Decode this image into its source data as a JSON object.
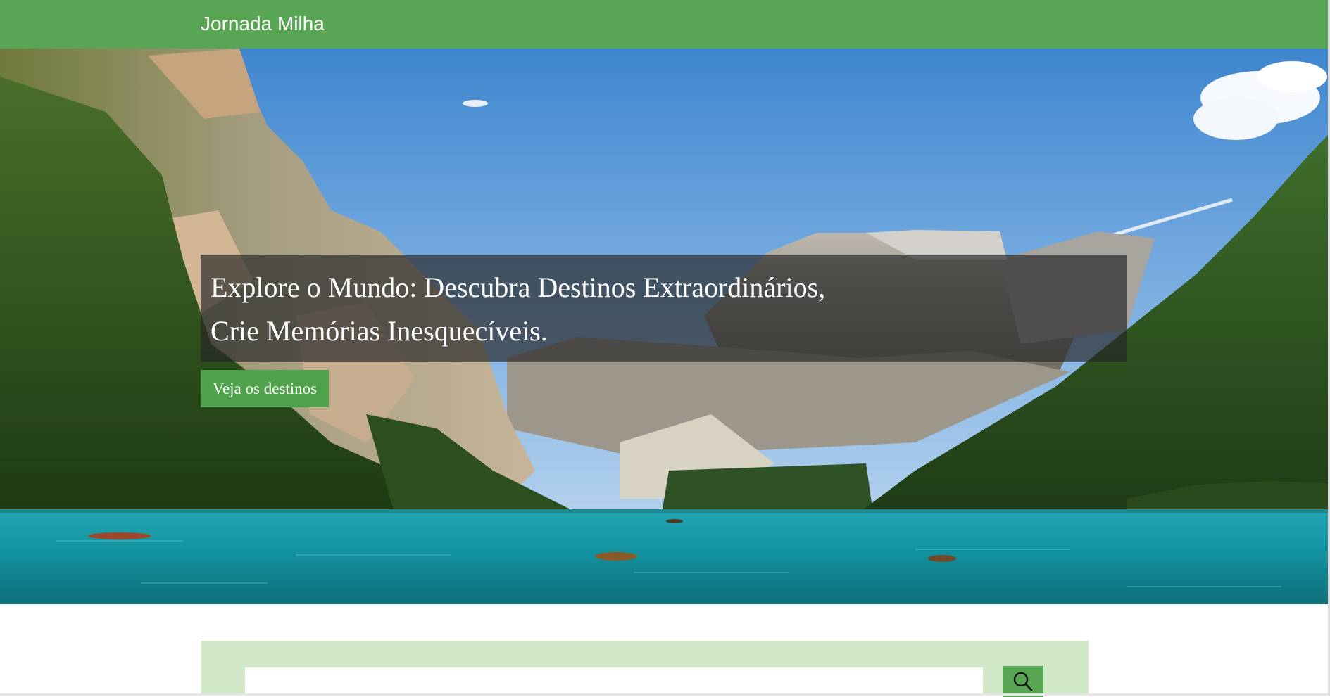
{
  "navbar": {
    "brand": "Jornada Milha",
    "background_color": "#58a653"
  },
  "hero": {
    "image_icon": "mountain-lake-image",
    "headline_line1": "Explore o Mundo: Descubra Destinos Extraordinários,",
    "headline_line2": "Crie Memórias Inesquecíveis.",
    "cta_label": "Veja os destinos",
    "cta_color": "#4fa24a"
  },
  "search": {
    "placeholder": "",
    "value": "",
    "button_icon": "search-icon",
    "panel_color": "#d1e8c8"
  }
}
